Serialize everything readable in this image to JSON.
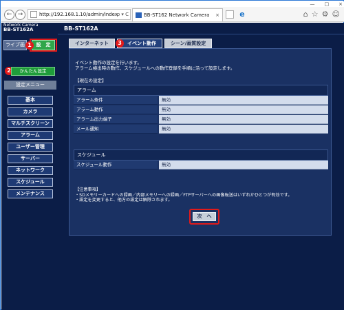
{
  "browser": {
    "address": "http://192.168.1.10/admin/index",
    "tab_title": "BB-ST162 Network Camera",
    "tab_close": "×",
    "nav_back_icon": "arrow-left-icon",
    "nav_forward_icon": "arrow-right-icon",
    "window_buttons": [
      "—",
      "□",
      "×"
    ],
    "address_tools": "ρ ▾ C",
    "right_icons": [
      "⌂",
      "☆",
      "⚙",
      "☺"
    ]
  },
  "brand": {
    "line1": "Network Camera",
    "model": "BB-ST162A"
  },
  "header": {
    "model": "BB-ST162A"
  },
  "sidebar": {
    "live_label": "ライブ画",
    "settings_label": "設　定",
    "easy_setup_label": "かんたん設定",
    "menu_header": "設定メニュー",
    "menu_items": [
      "基本",
      "カメラ",
      "マルチスクリーン",
      "アラーム",
      "ユーザー管理",
      "サーバー",
      "ネットワーク",
      "スケジュール",
      "メンテナンス"
    ]
  },
  "badges": [
    "1",
    "2",
    "3"
  ],
  "main": {
    "tabs": [
      "インターネット",
      "イベント動作",
      "シーン/画質設定"
    ],
    "active_tab": 1,
    "intro_line1": "イベント動作の設定を行います。",
    "intro_line2": "アラーム検出時の動作、スケジュールへの動作登録を手順に沿って設定します。",
    "current_settings_label": "【現在の設定】",
    "alarm_section": "アラーム",
    "alarm_rows": [
      {
        "label": "アラーム条件",
        "value": "無効"
      },
      {
        "label": "アラーム動作",
        "value": "無効"
      },
      {
        "label": "アラーム出力端子",
        "value": "無効"
      },
      {
        "label": "メール通知",
        "value": "無効"
      }
    ],
    "schedule_section": "スケジュール",
    "schedule_rows": [
      {
        "label": "スケジュール動作",
        "value": "無効"
      }
    ],
    "notes_title": "【注意事項】",
    "notes_line1": "・SDメモリーカードへの録画／内部メモリーへの録画／FTPサーバーへの画像転送はいずれかひとつが有効です。",
    "notes_line2": "・設定を変更すると、他方の設定は解除されます。",
    "next_button": "次　へ"
  },
  "colors": {
    "page_bg": "#0b1d47",
    "highlight_red": "#e21a1a",
    "settings_green": "#2fa64a"
  }
}
